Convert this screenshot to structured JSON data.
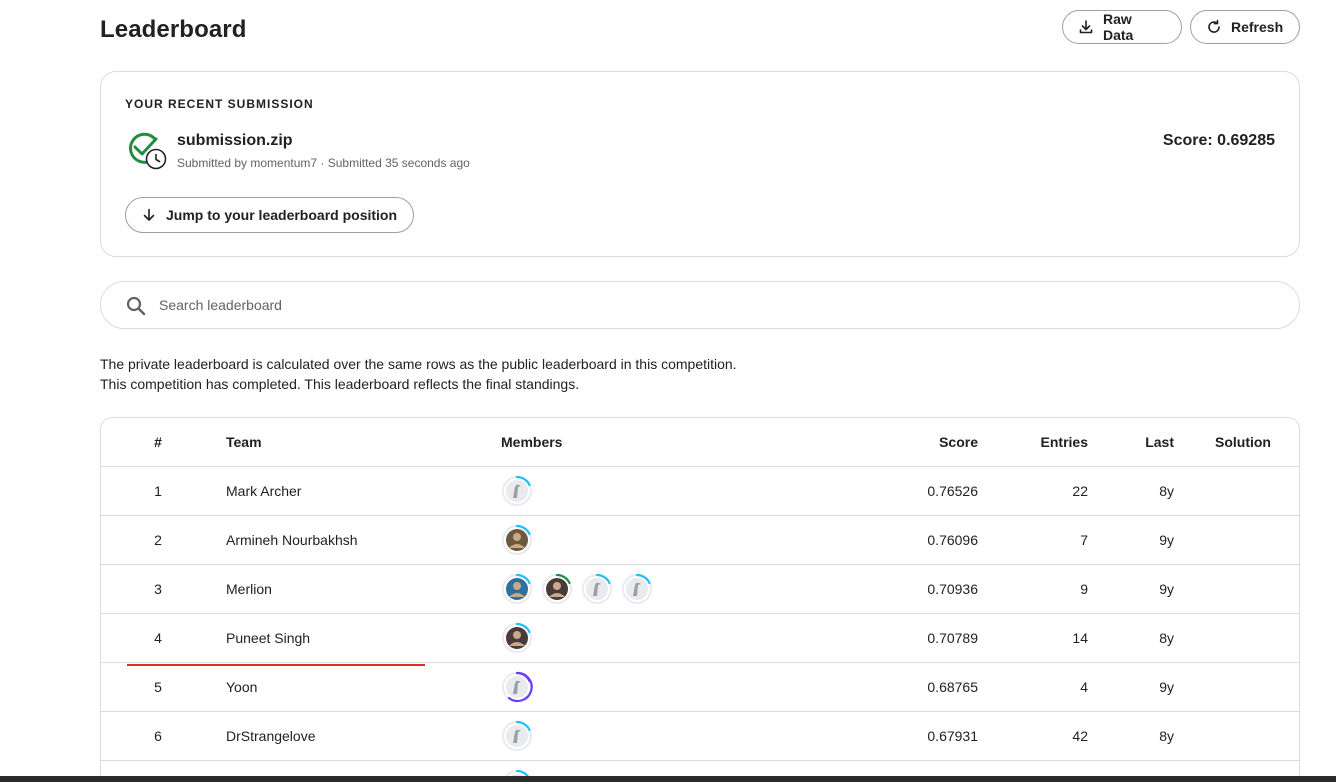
{
  "header": {
    "title": "Leaderboard",
    "raw_data_label": "Raw Data",
    "refresh_label": "Refresh"
  },
  "submission": {
    "heading": "YOUR RECENT SUBMISSION",
    "filename": "submission.zip",
    "meta": "Submitted by momentum7 · Submitted 35 seconds ago",
    "score": "Score: 0.69285",
    "jump_label": "Jump to your leaderboard position",
    "status_color": "#1e8e3e"
  },
  "search": {
    "placeholder": "Search leaderboard"
  },
  "notes": {
    "line1": "The private leaderboard is calculated over the same rows as the public leaderboard in this competition.",
    "line2": "This competition has completed. This leaderboard reflects the final standings."
  },
  "table": {
    "headers": {
      "rank": "#",
      "team": "Team",
      "members": "Members",
      "score": "Score",
      "entries": "Entries",
      "last": "Last",
      "solution": "Solution"
    },
    "rows": [
      {
        "rank": "1",
        "team": "Mark Archer",
        "score": "0.76526",
        "entries": "22",
        "last": "8y",
        "members": [
          {
            "type": "default-avatar",
            "ring": "#20beff"
          }
        ]
      },
      {
        "rank": "2",
        "team": "Armineh Nourbakhsh",
        "score": "0.76096",
        "entries": "7",
        "last": "9y",
        "members": [
          {
            "type": "photo-avatar",
            "ring": "#20beff"
          }
        ]
      },
      {
        "rank": "3",
        "team": "Merlion",
        "score": "0.70936",
        "entries": "9",
        "last": "9y",
        "members": [
          {
            "type": "photo-avatar",
            "ring": "#20beff"
          },
          {
            "type": "photo-avatar",
            "ring": "#1e8e3e"
          },
          {
            "type": "default-avatar",
            "ring": "#20beff"
          },
          {
            "type": "default-avatar",
            "ring": "#20beff"
          }
        ]
      },
      {
        "rank": "4",
        "team": "Puneet Singh",
        "score": "0.70789",
        "entries": "14",
        "last": "8y",
        "members": [
          {
            "type": "photo-avatar",
            "ring": "#20beff"
          }
        ]
      },
      {
        "rank": "5",
        "team": "Yoon",
        "score": "0.68765",
        "entries": "4",
        "last": "9y",
        "members": [
          {
            "type": "default-avatar",
            "ring": "#6e3cff"
          }
        ]
      },
      {
        "rank": "6",
        "team": "DrStrangelove",
        "score": "0.67931",
        "entries": "42",
        "last": "8y",
        "members": [
          {
            "type": "default-avatar",
            "ring": "#20beff"
          }
        ]
      },
      {
        "rank": "",
        "team": "",
        "score": "",
        "entries": "",
        "last": "",
        "members": [
          {
            "type": "default-avatar",
            "ring": "#20beff"
          }
        ]
      }
    ]
  },
  "colors": {
    "cutoff_line": "#d93025",
    "border": "#dadce0"
  }
}
